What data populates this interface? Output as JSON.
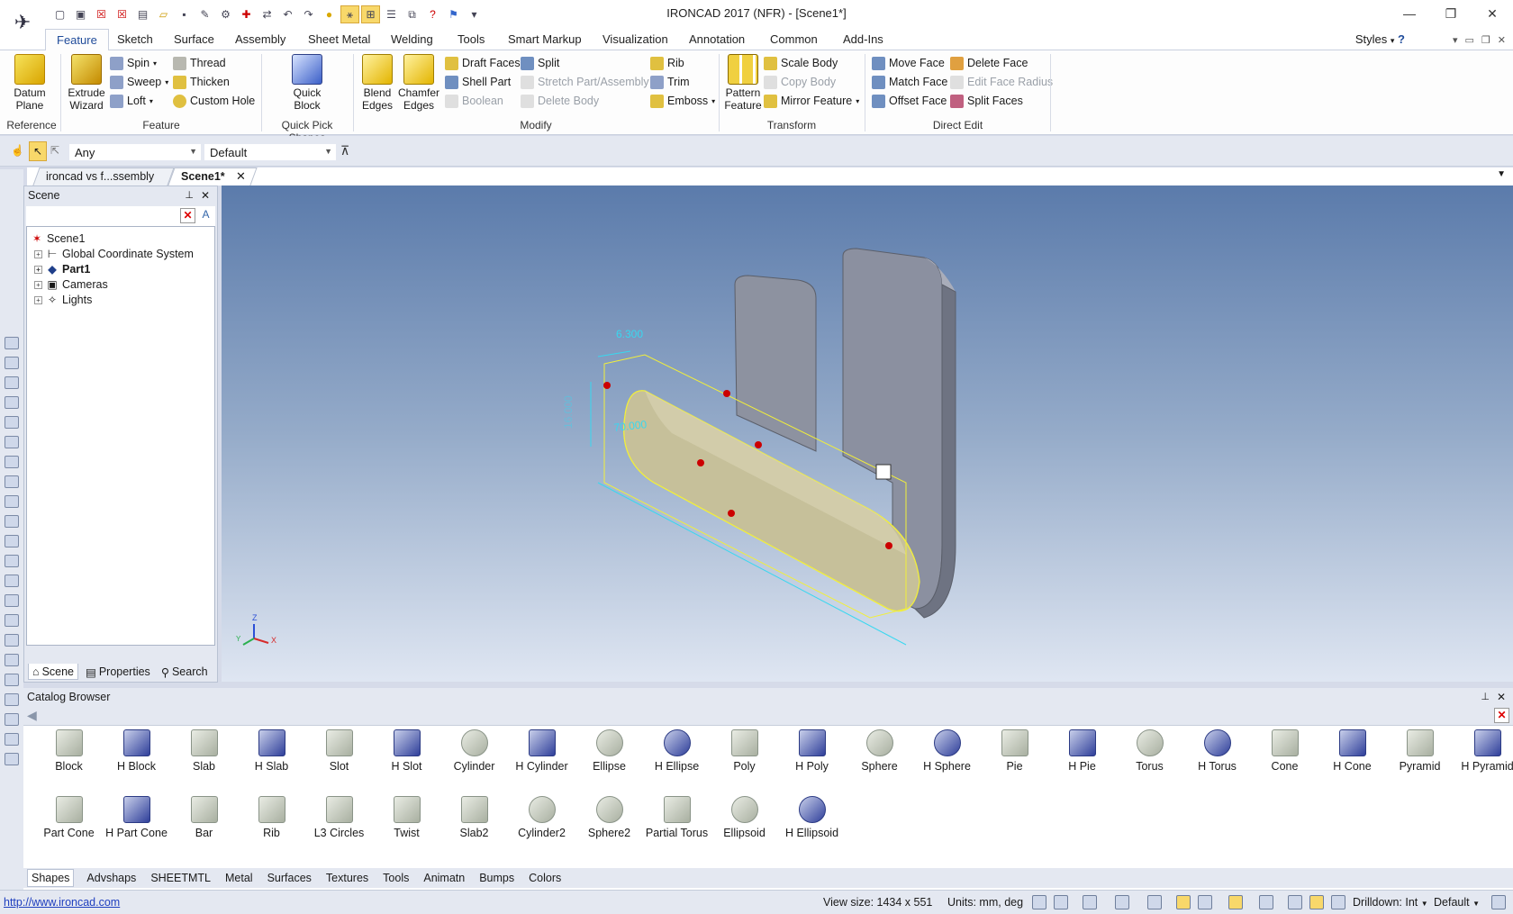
{
  "window": {
    "title": "IRONCAD 2017 (NFR) - [Scene1*]",
    "controls": [
      "minimize-icon",
      "restore-icon",
      "close-icon"
    ]
  },
  "quick_access_toolbar": {
    "icons": [
      "new-icon",
      "new-scene-icon",
      "close-doc-icon",
      "close-all-icon",
      "print-preview-icon",
      "open-icon",
      "save-icon",
      "save-as-icon",
      "import-icon",
      "insert-icon",
      "export-icon",
      "undo-icon",
      "redo-icon",
      "smart-snap-icon",
      "triball-icon",
      "snap-toggle-icon",
      "properties-icon",
      "copy-icon",
      "help-icon",
      "learn-icon"
    ],
    "more": "▾"
  },
  "ribbon_tabs": [
    "Feature",
    "Sketch",
    "Surface",
    "Assembly",
    "Sheet Metal",
    "Welding",
    "Tools",
    "Smart Markup",
    "Visualization",
    "Annotation",
    "Common",
    "Add-Ins"
  ],
  "active_tab": "Feature",
  "styles_label": "Styles",
  "ribbon": {
    "reference": {
      "label": "Reference",
      "datum_plane": "Datum\nPlane"
    },
    "feature": {
      "label": "Feature",
      "extrude_wizard": "Extrude\nWizard",
      "spin": "Spin",
      "sweep": "Sweep",
      "loft": "Loft",
      "thread": "Thread",
      "thicken": "Thicken",
      "custom_hole": "Custom Hole"
    },
    "quick_pick": {
      "label": "Quick Pick Shapes",
      "quick_block": "Quick\nBlock"
    },
    "modify": {
      "label": "Modify",
      "blend_edges": "Blend\nEdges",
      "chamfer_edges": "Chamfer\nEdges",
      "draft_faces": "Draft Faces",
      "shell_part": "Shell Part",
      "boolean": "Boolean",
      "split": "Split",
      "stretch": "Stretch Part/Assembly",
      "delete_body": "Delete Body",
      "rib": "Rib",
      "trim": "Trim",
      "emboss": "Emboss"
    },
    "transform": {
      "label": "Transform",
      "pattern_feature": "Pattern\nFeature",
      "scale_body": "Scale Body",
      "copy_body": "Copy Body",
      "mirror_feature": "Mirror Feature"
    },
    "direct_edit": {
      "label": "Direct Edit",
      "move_face": "Move Face",
      "match_face": "Match Face",
      "offset_face": "Offset Face",
      "delete_face": "Delete Face",
      "edit_face_radius": "Edit Face Radius",
      "split_faces": "Split Faces"
    }
  },
  "selection_bar": {
    "filter": "Any",
    "style": "Default"
  },
  "doc_tabs": [
    "ironcad vs f...ssembly",
    "Scene1*"
  ],
  "scene_panel": {
    "title": "Scene",
    "tree": [
      {
        "label": "Scene1",
        "icon": "scene-icon"
      },
      {
        "label": "Global Coordinate System",
        "icon": "coordinate-system-icon"
      },
      {
        "label": "Part1",
        "icon": "part-icon"
      },
      {
        "label": "Cameras",
        "icon": "camera-icon"
      },
      {
        "label": "Lights",
        "icon": "light-icon"
      }
    ],
    "footer_tabs": [
      "Scene",
      "Properties",
      "Search"
    ]
  },
  "viewport": {
    "dimensions": {
      "width_dim": "6.300",
      "height_dim": "16.000",
      "length_dim": "70.000"
    },
    "axes": {
      "z": "Z",
      "x": "X",
      "y": "Y"
    }
  },
  "catalog": {
    "title": "Catalog Browser",
    "items_row1": [
      "Block",
      "H Block",
      "Slab",
      "H Slab",
      "Slot",
      "H Slot",
      "Cylinder",
      "H Cylinder",
      "Ellipse",
      "H Ellipse",
      "Poly",
      "H Poly",
      "Sphere",
      "H Sphere",
      "Pie",
      "H Pie",
      "Torus",
      "H Torus",
      "Cone",
      "H Cone",
      "Pyramid",
      "H Pyramid"
    ],
    "items_row2": [
      "Part Cone",
      "H Part Cone",
      "Bar",
      "Rib",
      "L3 Circles",
      "Twist",
      "Slab2",
      "Cylinder2",
      "Sphere2",
      "Partial Torus",
      "Ellipsoid",
      "H Ellipsoid"
    ],
    "tabs": [
      "Shapes",
      "Advshaps",
      "SHEETMTL",
      "Metal",
      "Surfaces",
      "Textures",
      "Tools",
      "Animatn",
      "Bumps",
      "Colors"
    ]
  },
  "status_bar": {
    "link": "http://www.ironcad.com",
    "view_size": "View size: 1434 x  551",
    "units": "Units: mm, deg",
    "drilldown": "Drilldown: Int",
    "style": "Default"
  },
  "colors": {
    "accent": "#1f4b9a",
    "viewport_top": "#5b7bab",
    "viewport_bottom": "#dfe6f2",
    "dimension": "#38d8f0",
    "part": "#c9c29a",
    "selected_edge": "#f2ef3a"
  }
}
